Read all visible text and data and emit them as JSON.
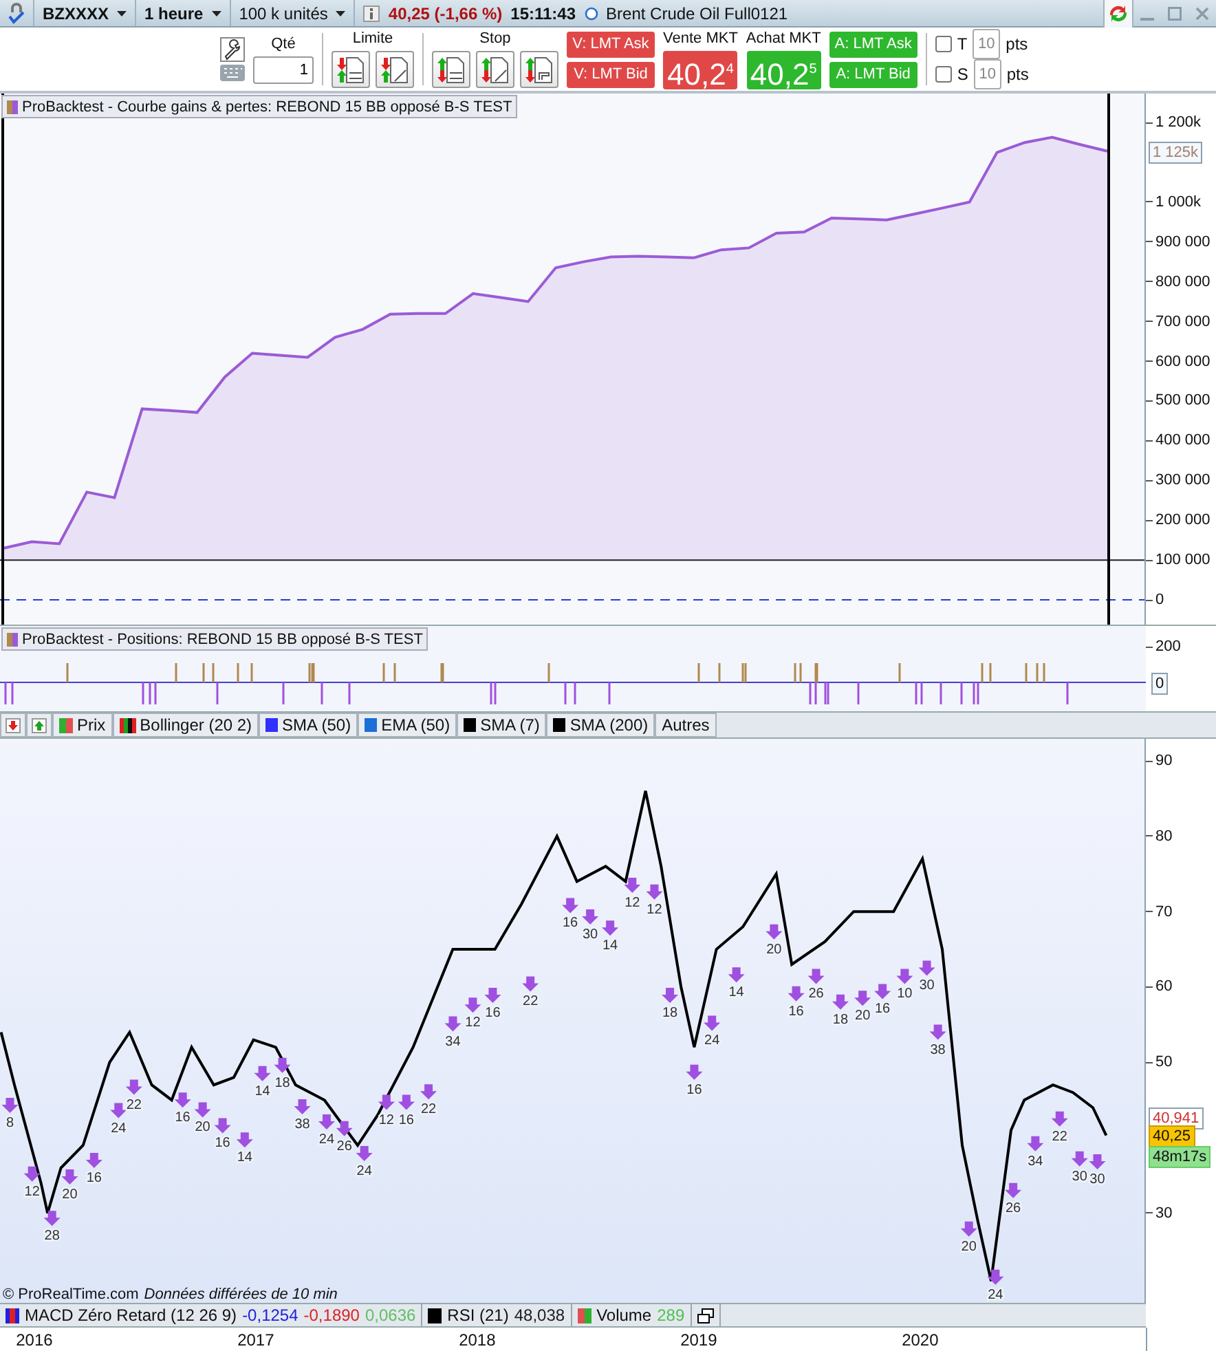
{
  "title_bar": {
    "instrument": "BZXXXX",
    "timeframe": "1 heure",
    "quantity": "100 k unités",
    "quote": "40,25 (-1,66 %)",
    "time": "15:11:43",
    "name": "Brent Crude Oil Full0121"
  },
  "toolbar": {
    "qty_label": "Qté",
    "qty": "1",
    "limit_label": "Limite",
    "stop_label": "Stop",
    "sell_buttons": [
      "V: LMT Ask",
      "V: LMT Bid"
    ],
    "sell_label": "Vente MKT",
    "sell_price": "40,2$^{4}$",
    "buy_label": "Achat MKT",
    "buy_price": "40,2$^{5}$",
    "buy_buttons": [
      "A: LMT Ask",
      "A: LMT Bid"
    ],
    "brackets": [
      {
        "label": "T",
        "checked": false,
        "value": "10",
        "unit": "pts"
      },
      {
        "label": "S",
        "checked": false,
        "value": "10",
        "unit": "pts"
      }
    ]
  },
  "equity_panel": {
    "title": "ProBacktest - Courbe gains & pertes: REBOND 15 BB opposé B-S TEST",
    "current_badge": "1 125k",
    "chart_data": {
      "type": "area",
      "ylim": [
        -65700,
        1273000
      ],
      "ref_lines": [
        {
          "axis": "y",
          "value": 100000,
          "color": "#222222"
        },
        {
          "axis": "y",
          "value": 0,
          "color": "#2a3cc8"
        }
      ],
      "categories": [
        null,
        null,
        null,
        null,
        null,
        null,
        null,
        null,
        null,
        null,
        null,
        null,
        null,
        null,
        null,
        null,
        null,
        null,
        null,
        null,
        null,
        null,
        null,
        null,
        null,
        null,
        null,
        null,
        null,
        null,
        null,
        null,
        null,
        null,
        null,
        null,
        null,
        null,
        null,
        null,
        null
      ],
      "series": [
        {
          "color": "#9b5bd6",
          "values": [
            130000,
            146000,
            141000,
            271000,
            257000,
            480000,
            476000,
            471000,
            560000,
            620000,
            615000,
            610000,
            660000,
            680000,
            718000,
            720000,
            720000,
            770000,
            760000,
            750000,
            835000,
            850000,
            862000,
            864000,
            862000,
            860000,
            880000,
            885000,
            922000,
            925000,
            960000,
            958000,
            955000,
            970000,
            985000,
            1000000,
            1125000,
            1150000,
            1163000,
            1145000,
            1128000
          ]
        }
      ],
      "yticks": [
        {
          "value": 1200000,
          "label": "1 200k"
        },
        {
          "value": 1000000,
          "label": "1 000k"
        },
        {
          "value": 900000,
          "label": "900 000"
        },
        {
          "value": 800000,
          "label": "800 000"
        },
        {
          "value": 700000,
          "label": "700 000"
        },
        {
          "value": 600000,
          "label": "600 000"
        },
        {
          "value": 500000,
          "label": "500 000"
        },
        {
          "value": 400000,
          "label": "400 000"
        },
        {
          "value": 300000,
          "label": "300 000"
        },
        {
          "value": 200000,
          "label": "200 000"
        },
        {
          "value": 100000,
          "label": "100 000"
        },
        {
          "value": 0,
          "label": "0"
        }
      ]
    }
  },
  "positions_panel": {
    "title": "ProBacktest - Positions: REBOND 15 BB opposé B-S TEST",
    "tick": "200",
    "zero_badge": "0"
  },
  "legend": [
    {
      "label": "Prix",
      "kind": "split",
      "color": "#e05050"
    },
    {
      "label": "Bollinger (20 2)",
      "kind": "bands",
      "color": "#20a020"
    },
    {
      "label": "SMA (50)",
      "kind": "swatch",
      "color": "#3030ff"
    },
    {
      "label": "EMA (50)",
      "kind": "swatch",
      "color": "#1a6fd8"
    },
    {
      "label": "SMA (7)",
      "kind": "swatch",
      "color": "#000000"
    },
    {
      "label": "SMA (200)",
      "kind": "swatch",
      "color": "#000000"
    },
    {
      "label": "Autres",
      "kind": "text"
    }
  ],
  "price_panel": {
    "copyright": "© ProRealTime.com",
    "delay_note": "Données différées de 10 min",
    "previous_badge": "40,941",
    "last_badge": "40,25",
    "countdown": "48m17s",
    "chart_data": {
      "type": "line",
      "xlim": [
        2015.845,
        2021.019
      ],
      "ylim": [
        18.1,
        92.92
      ],
      "x": [
        2015.85,
        2015.91,
        2016.03,
        2016.06,
        2016.12,
        2016.22,
        2016.34,
        2016.43,
        2016.53,
        2016.62,
        2016.71,
        2016.81,
        2016.9,
        2016.99,
        2017.09,
        2017.18,
        2017.31,
        2017.46,
        2017.55,
        2017.71,
        2017.89,
        2018.08,
        2018.2,
        2018.36,
        2018.45,
        2018.58,
        2018.67,
        2018.76,
        2018.83,
        2018.92,
        2018.98,
        2019.08,
        2019.2,
        2019.35,
        2019.42,
        2019.57,
        2019.7,
        2019.88,
        2020.01,
        2020.1,
        2020.19,
        2020.26,
        2020.32,
        2020.41,
        2020.47,
        2020.6,
        2020.69,
        2020.78,
        2020.84
      ],
      "series": [
        {
          "color": "#000000",
          "values": [
            54,
            47,
            34,
            30,
            36,
            39,
            50,
            54,
            47,
            45,
            52,
            47,
            48,
            53,
            52,
            47,
            45,
            39,
            43,
            52,
            65,
            65,
            71,
            80,
            74,
            76,
            74,
            86,
            76,
            60,
            52,
            65,
            68,
            75,
            63,
            66,
            70,
            70,
            77,
            65,
            39,
            29,
            21,
            41,
            45,
            47,
            46,
            44,
            40.3
          ]
        }
      ],
      "xticks": [
        {
          "value": 2016,
          "label": "2016"
        },
        {
          "value": 2017,
          "label": "2017"
        },
        {
          "value": 2018,
          "label": "2018"
        },
        {
          "value": 2019,
          "label": "2019"
        },
        {
          "value": 2020,
          "label": "2020"
        }
      ],
      "yticks": [
        {
          "value": 90,
          "label": "90"
        },
        {
          "value": 80,
          "label": "80"
        },
        {
          "value": 70,
          "label": "70"
        },
        {
          "value": 60,
          "label": "60"
        },
        {
          "value": 50,
          "label": "50"
        },
        {
          "value": 30,
          "label": "30"
        }
      ]
    },
    "markers": [
      "8",
      "12",
      "28",
      "20",
      "16",
      "24",
      "22",
      "16",
      "20",
      "16",
      "14",
      "14",
      "18",
      "38",
      "24",
      "26",
      "24",
      "12",
      "16",
      "22",
      "34",
      "12",
      "16",
      "22",
      "16",
      "30",
      "14",
      "12",
      "12",
      "18",
      "16",
      "24",
      "14",
      "20",
      "16",
      "26",
      "18",
      "20",
      "16",
      "10",
      "30",
      "38",
      "20",
      "24",
      "26",
      "34",
      "22",
      "30",
      "30"
    ]
  },
  "indicators": [
    {
      "name": "MACD Zéro Retard (12 26 9)",
      "kind": "macd",
      "values": [
        {
          "text": "-0,1254",
          "color": "#2020e0"
        },
        {
          "text": "-0,1890",
          "color": "#e02020"
        },
        {
          "text": "0,0636",
          "color": "#60c060"
        }
      ]
    },
    {
      "name": "RSI (21)",
      "kind": "rsi",
      "values": [
        {
          "text": "48,038",
          "color": "#202020"
        }
      ]
    },
    {
      "name": "Volume",
      "kind": "volume",
      "values": [
        {
          "text": "289",
          "color": "#50c050"
        }
      ]
    }
  ]
}
